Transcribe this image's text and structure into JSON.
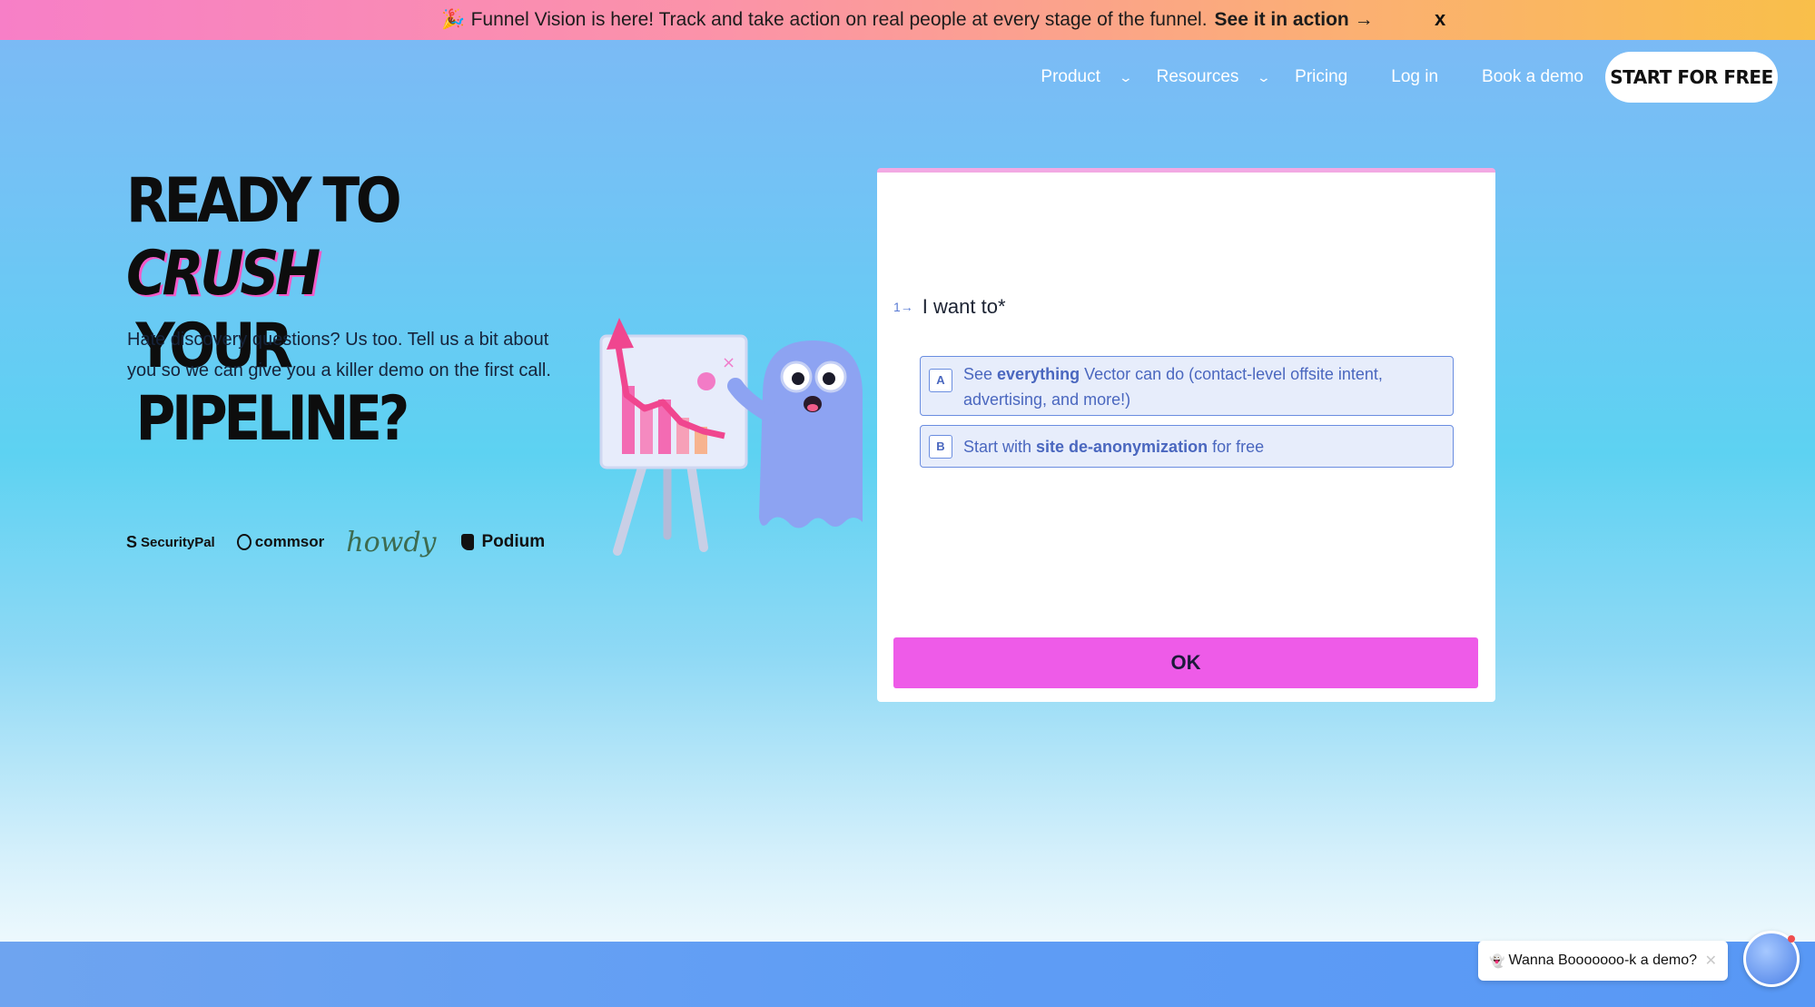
{
  "announcement": {
    "emoji": "🎉",
    "text": "Funnel Vision is here! Track and take action on real people at every stage of the funnel.",
    "link": "See it in action →",
    "close": "x"
  },
  "nav": {
    "product": "Product",
    "resources": "Resources",
    "pricing": "Pricing",
    "login": "Log in",
    "book_demo": "Book a demo",
    "start": "START FOR FREE",
    "chevron": "⌄"
  },
  "hero": {
    "title_part1": "READY TO ",
    "title_highlight": "CRUSH",
    "title_line2": "YOUR PIPELINE?",
    "subtitle": "Hate discovery questions? Us too. Tell us a bit about you so we can give you a killer demo on the first call."
  },
  "logos": {
    "securitypal": "SecurityPal",
    "securitypal_mark": "S",
    "commsor": "commsor",
    "howdy": "howdy",
    "podium": "Podium"
  },
  "form": {
    "question_number": "1→",
    "question": "I want to*",
    "option_a": {
      "key": "A",
      "pre": "See ",
      "bold": "everything",
      "post": " Vector can do (contact-level offsite intent, advertising, and more!)"
    },
    "option_b": {
      "key": "B",
      "pre": "Start with ",
      "bold": "site de-anonymization",
      "post": " for free"
    },
    "ok": "OK"
  },
  "chat": {
    "emoji": "👻",
    "text": "Wanna Booooooo-k a demo?",
    "close": "✕"
  },
  "colors": {
    "accent_pink": "#ee5be8",
    "option_blue": "#4a67bf",
    "announce_start": "#f77fc7",
    "announce_end": "#f9bf4a"
  },
  "icons": [
    "party-icon",
    "chevron-down-icon",
    "close-icon",
    "ghost-icon"
  ]
}
